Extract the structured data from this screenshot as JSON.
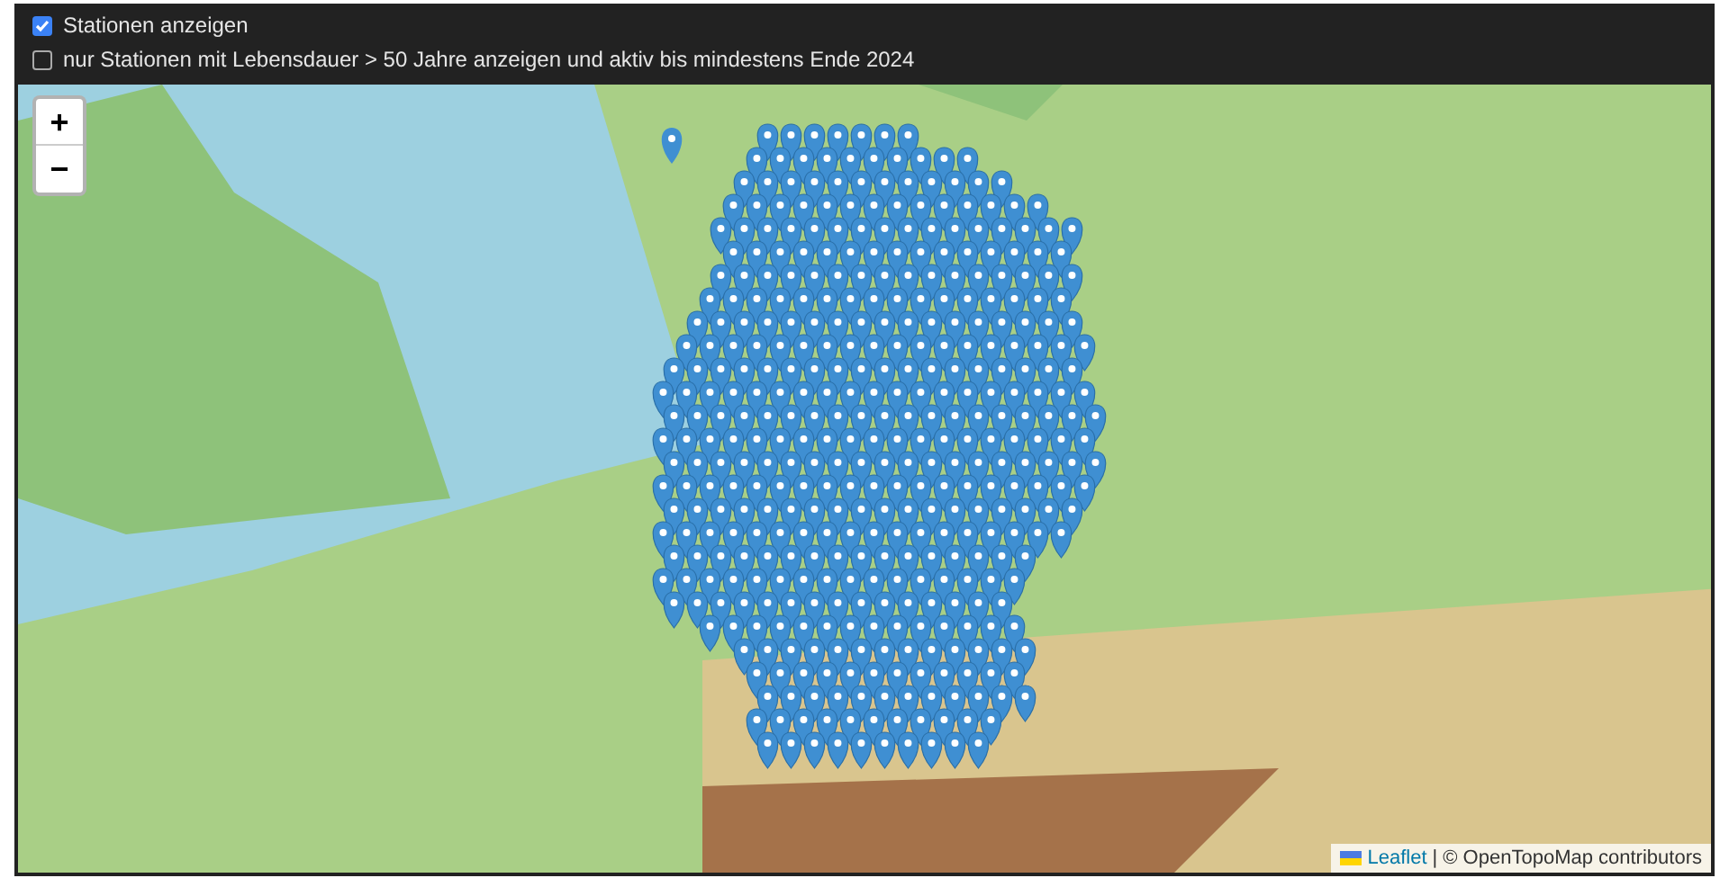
{
  "filters": [
    {
      "label": "Stationen anzeigen",
      "checked": true
    },
    {
      "label": "nur Stationen mit Lebensdauer > 50 Jahre anzeigen und aktiv bis mindestens Ende 2024",
      "checked": false
    }
  ],
  "map": {
    "zoom_controls": [
      "+",
      "−"
    ],
    "attribution": {
      "link": "Leaflet",
      "separator": "|",
      "text": "© OpenTopoMap contributors"
    }
  }
}
